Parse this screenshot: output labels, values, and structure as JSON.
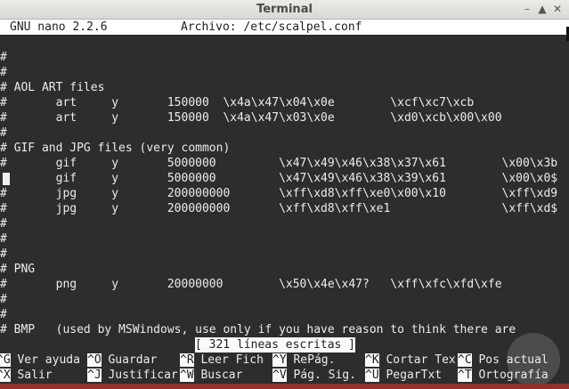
{
  "window": {
    "title": "Terminal"
  },
  "header": {
    "program": "GNU nano 2.2.6",
    "file_label": "Archivo: /etc/scalpel.conf"
  },
  "lines": [
    "#",
    "#",
    "# AOL ART files",
    "#       art     y       150000  \\x4a\\x47\\x04\\x0e        \\xcf\\xc7\\xcb",
    "#       art     y       150000  \\x4a\\x47\\x03\\x0e        \\xd0\\xcb\\x00\\x00",
    "#",
    "# GIF and JPG files (very common)",
    "#       gif     y       5000000         \\x47\\x49\\x46\\x38\\x37\\x61        \\x00\\x3b",
    "        gif     y       5000000         \\x47\\x49\\x46\\x38\\x39\\x61        \\x00\\x0$",
    "#       jpg     y       200000000       \\xff\\xd8\\xff\\xe0\\x00\\x10        \\xff\\xd9",
    "#       jpg     y       200000000       \\xff\\xd8\\xff\\xe1                \\xff\\xd$",
    "#",
    "#",
    "#",
    "# PNG",
    "#       png     y       20000000        \\x50\\x4e\\x47?   \\xff\\xfc\\xfd\\xfe",
    "#",
    "#",
    "# BMP   (used by MSWindows, use only if you have reason to think there are"
  ],
  "status": "[ 321 líneas escritas ]",
  "shortcuts_row1": [
    {
      "key": "^G",
      "label": "Ver ayuda"
    },
    {
      "key": "^O",
      "label": "Guardar"
    },
    {
      "key": "^R",
      "label": "Leer Fich"
    },
    {
      "key": "^Y",
      "label": "RePág."
    },
    {
      "key": "^K",
      "label": "Cortar Tex"
    },
    {
      "key": "^C",
      "label": "Pos actual"
    }
  ],
  "shortcuts_row2": [
    {
      "key": "^X",
      "label": "Salir"
    },
    {
      "key": "^J",
      "label": "Justificar"
    },
    {
      "key": "^W",
      "label": "Buscar"
    },
    {
      "key": "^V",
      "label": "Pág. Sig."
    },
    {
      "key": "^U",
      "label": "PegarTxt"
    },
    {
      "key": "^T",
      "label": "Ortografía"
    }
  ]
}
